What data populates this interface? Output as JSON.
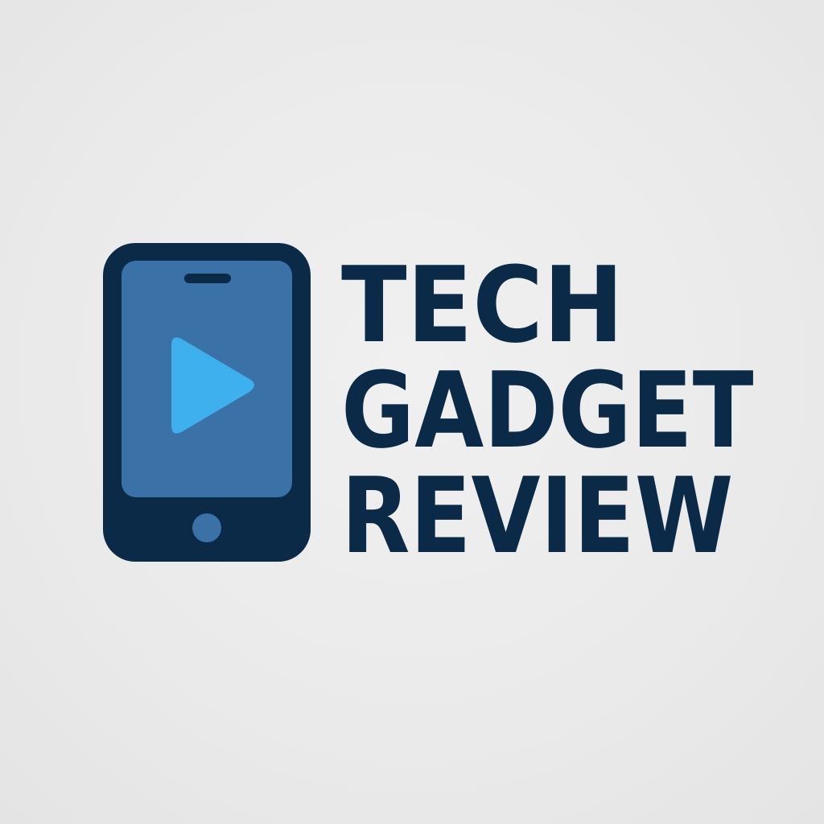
{
  "logo": {
    "icon": "smartphone-play-icon",
    "colors": {
      "background": "#ececec",
      "phone_body": "#0b2a47",
      "phone_screen": "#3a72a8",
      "play_button": "#3fb0ee",
      "wordmark": "#0b2a47"
    },
    "wordmark": {
      "line1": "TECH",
      "line2": "GADGET",
      "line3": "REVIEW"
    }
  }
}
